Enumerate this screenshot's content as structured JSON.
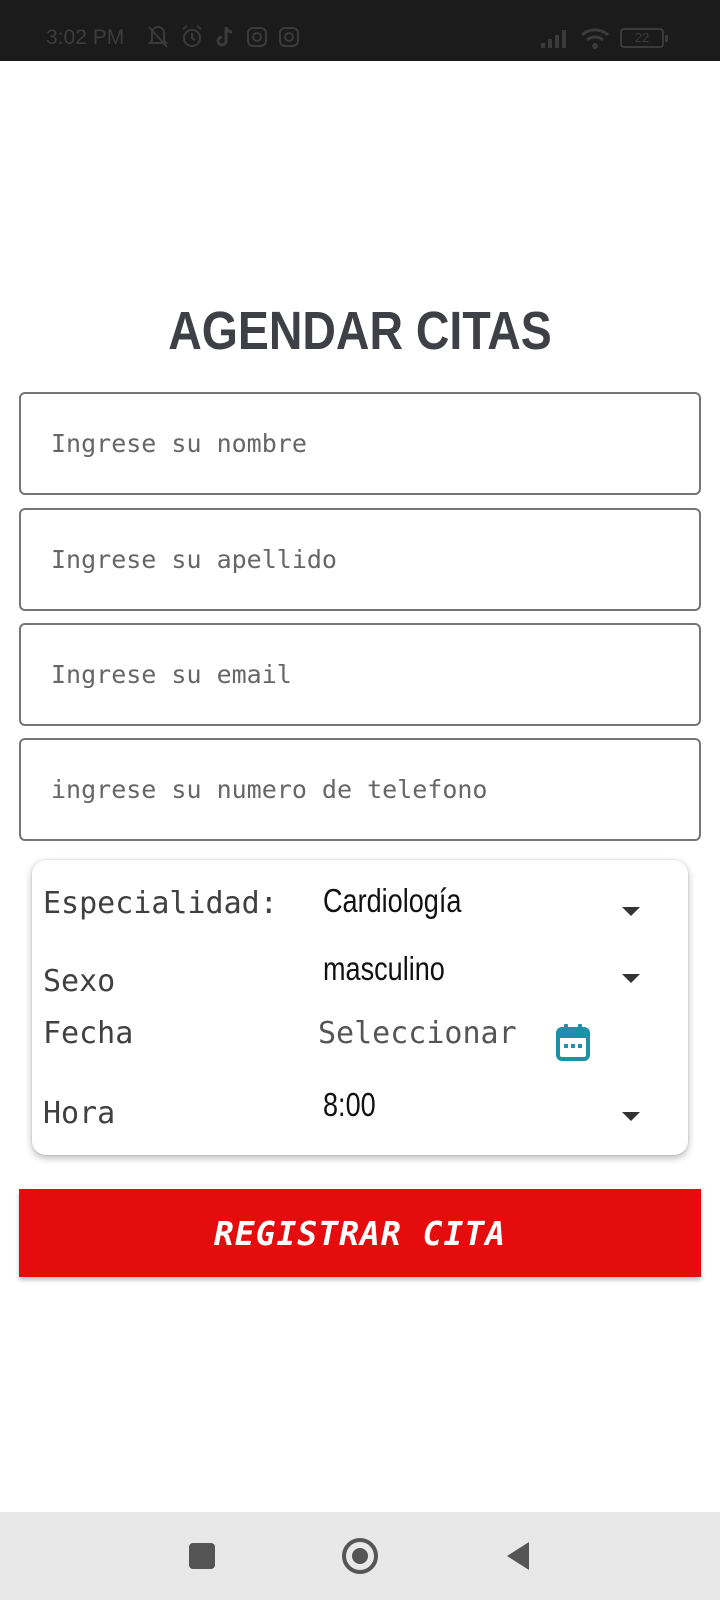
{
  "status_bar": {
    "time": "3:02 PM",
    "left_icons": [
      "notifications-off-icon",
      "alarm-icon",
      "tiktok-icon",
      "instagram-icon",
      "instagram-icon"
    ],
    "right_icons": [
      "signal-icon",
      "wifi-icon",
      "battery-icon"
    ],
    "battery_level": "22"
  },
  "page": {
    "title": "AGENDAR CITAS"
  },
  "form": {
    "nombre_placeholder": "Ingrese su nombre",
    "apellido_placeholder": "Ingrese su apellido",
    "email_placeholder": "Ingrese su email",
    "telefono_placeholder": "ingrese su numero de telefono"
  },
  "card": {
    "especialidad_label": "Especialidad:",
    "especialidad_value": "Cardiología",
    "sexo_label": "Sexo",
    "sexo_value": "masculino",
    "fecha_label": "Fecha",
    "fecha_value": "Seleccionar",
    "hora_label": "Hora",
    "hora_value": "8:00"
  },
  "actions": {
    "register_label": "REGISTRAR CITA"
  },
  "colors": {
    "accent_red": "#e40c0c",
    "calendar_teal": "#1e90a8",
    "title_gray": "#3f4046"
  },
  "nav_bar": {
    "buttons": [
      "recents-square-icon",
      "home-circle-icon",
      "back-triangle-icon"
    ]
  }
}
